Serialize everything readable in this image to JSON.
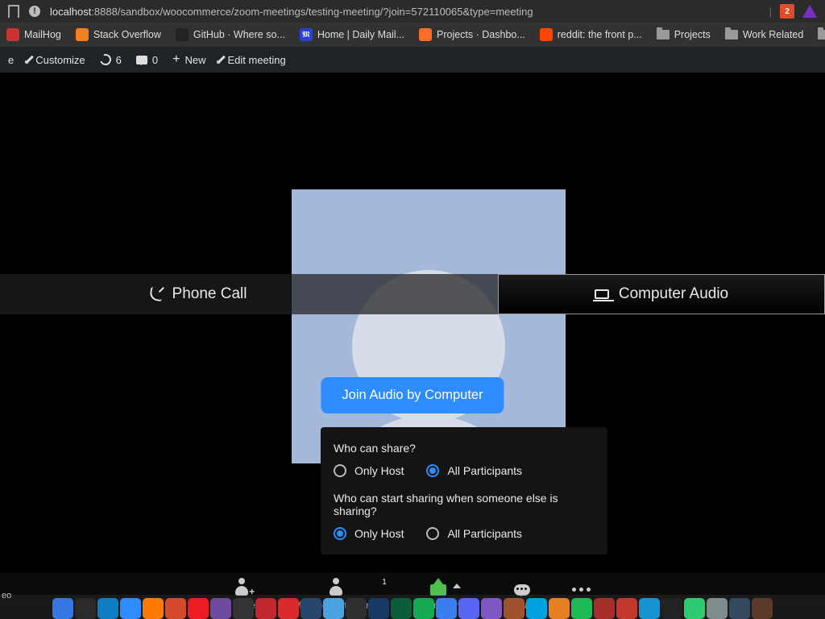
{
  "browser": {
    "url_host": "localhost",
    "url_rest": ":8888/sandbox/woocommerce/zoom-meetings/testing-meeting/?join=572110065&type=meeting",
    "shield_count": "2",
    "bookmarks": [
      {
        "label": "MailHog",
        "fav": "red"
      },
      {
        "label": "Stack Overflow",
        "fav": "orange"
      },
      {
        "label": "GitHub · Where so...",
        "fav": "dark"
      },
      {
        "label": "Home | Daily Mail...",
        "fav": "blue"
      },
      {
        "label": "Projects · Dashbo...",
        "fav": "gl"
      },
      {
        "label": "reddit: the front p...",
        "fav": "rd"
      },
      {
        "label": "Projects",
        "fav": "folder"
      },
      {
        "label": "Work Related",
        "fav": "folder"
      },
      {
        "label": "Tutorial",
        "fav": "folder"
      }
    ]
  },
  "wpbar": {
    "site_suffix": "e",
    "customize": "Customize",
    "refresh_count": "6",
    "comments_count": "0",
    "new": "New",
    "edit": "Edit meeting"
  },
  "audio": {
    "phone_tab": "Phone Call",
    "computer_tab": "Computer Audio",
    "join_btn": "Join Audio by Computer"
  },
  "share_panel": {
    "q1": "Who can share?",
    "q2": "Who can start sharing when someone else is sharing?",
    "only_host": "Only Host",
    "all_participants": "All Participants",
    "q1_selected": "all",
    "q2_selected": "host"
  },
  "toolbar": {
    "video_label": "eo",
    "invite": "Invite",
    "manage": "Manage Participants",
    "manage_count": "1",
    "share": "Share Screen",
    "chat": "Chat",
    "more": "More"
  },
  "dock_colors": [
    "#3477e0",
    "#2a2a2a",
    "#0f7dc2",
    "#2d8cff",
    "#ff7a00",
    "#d44a2a",
    "#ed1c24",
    "#6e4b9e",
    "#333",
    "#c1272d",
    "#d92b2b",
    "#26466d",
    "#4aa3df",
    "#2f2f2f",
    "#163a63",
    "#0a5f3a",
    "#13aa52",
    "#3b7ded",
    "#5865f2",
    "#7e57c2",
    "#a0522d",
    "#00a1e0",
    "#e67e22",
    "#1db954",
    "#a72f2b",
    "#c0392b",
    "#1793d1",
    "#222",
    "#2ecc71",
    "#7f8c8d",
    "#34495e",
    "#5b3a29"
  ]
}
